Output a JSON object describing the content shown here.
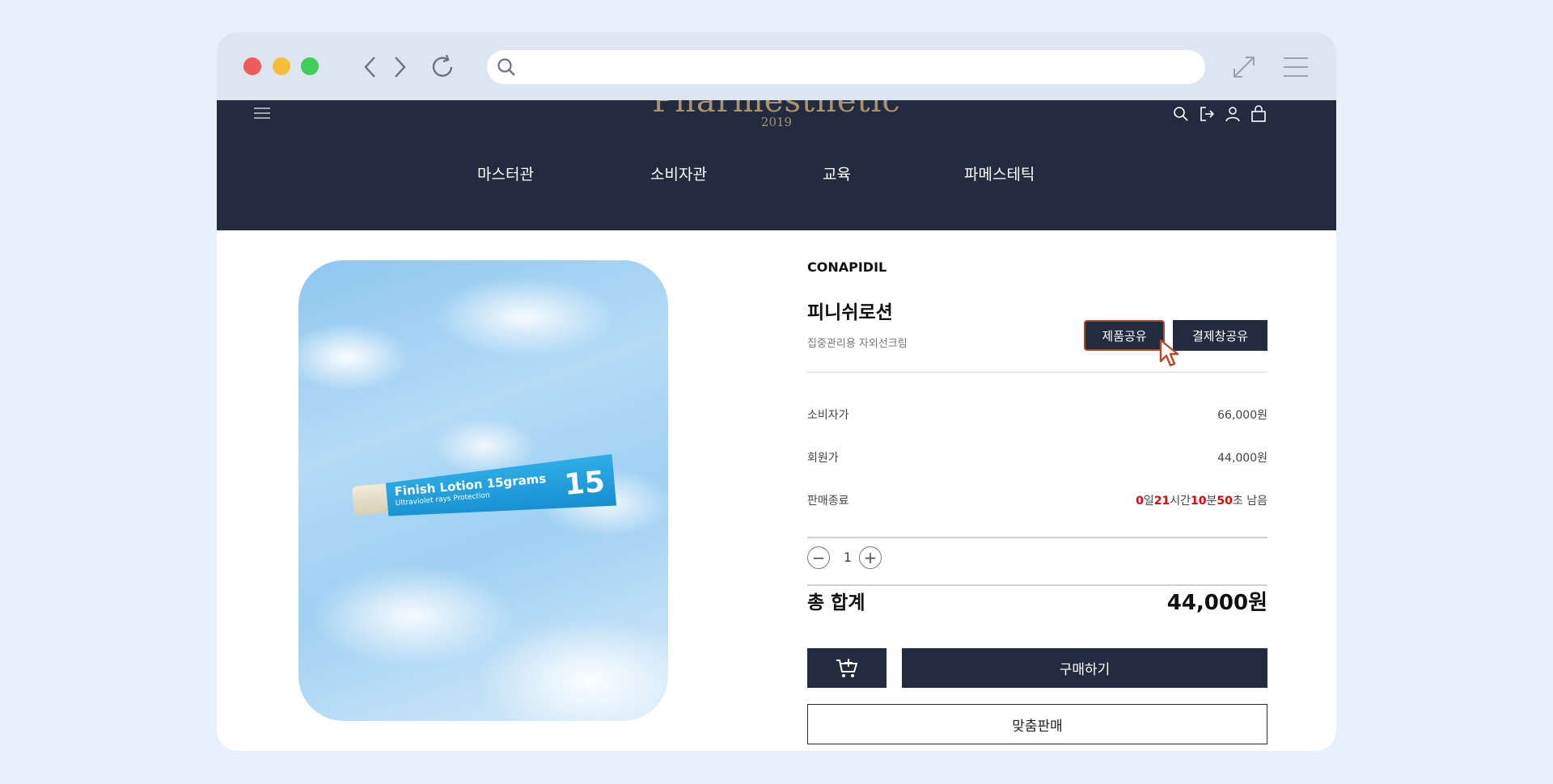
{
  "browser": {
    "url": ""
  },
  "site": {
    "logo": "Pharmesthetic",
    "logo_year": "2019",
    "nav": [
      "마스터관",
      "소비자관",
      "교육",
      "파메스테틱"
    ]
  },
  "product": {
    "brand": "CONAPIDIL",
    "name": "피니쉬로션",
    "description": "집중관리용 자외선크림",
    "share_product_label": "제품공유",
    "share_checkout_label": "결제창공유",
    "image_text": {
      "line1": "Finish Lotion 15grams",
      "line2": "Ultraviolet rays Protection",
      "number": "15"
    }
  },
  "prices": {
    "consumer_label": "소비자가",
    "consumer_value": "66,000원",
    "member_label": "회원가",
    "member_value": "44,000원",
    "sale_end_label": "판매종료"
  },
  "timer": {
    "days": "0",
    "days_unit": "일",
    "hours": "21",
    "hours_unit": "시간",
    "minutes": "10",
    "minutes_unit": "분",
    "seconds": "50",
    "seconds_unit": "초 남음"
  },
  "quantity": {
    "value": "1",
    "minus": "−",
    "plus": "+"
  },
  "total": {
    "label": "총 합계",
    "value": "44,000원"
  },
  "actions": {
    "buy_label": "구매하기",
    "custom_label": "맞춤판매"
  },
  "colors": {
    "navy": "#222b3f",
    "gold": "#a99270",
    "timer_red": "#e10000",
    "highlight_border": "#b5482a"
  }
}
